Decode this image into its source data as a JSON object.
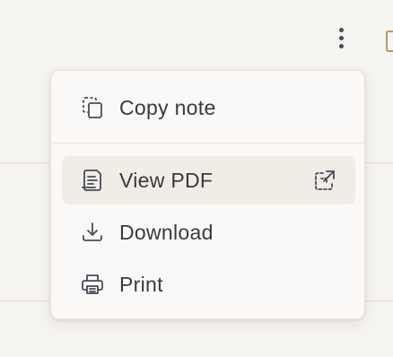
{
  "menu": {
    "items": [
      {
        "label": "Copy note",
        "icon": "copy-icon"
      },
      {
        "label": "View PDF",
        "icon": "document-icon",
        "trailing_icon": "external-link-icon",
        "highlighted": true
      },
      {
        "label": "Download",
        "icon": "download-icon"
      },
      {
        "label": "Print",
        "icon": "printer-icon"
      }
    ]
  },
  "toolbar": {
    "more_icon": "kebab-menu-icon"
  },
  "colors": {
    "background": "#f6f4f0",
    "menu_bg": "#faf9f7",
    "highlight": "#f0ece6",
    "icon": "#4a4a58"
  }
}
